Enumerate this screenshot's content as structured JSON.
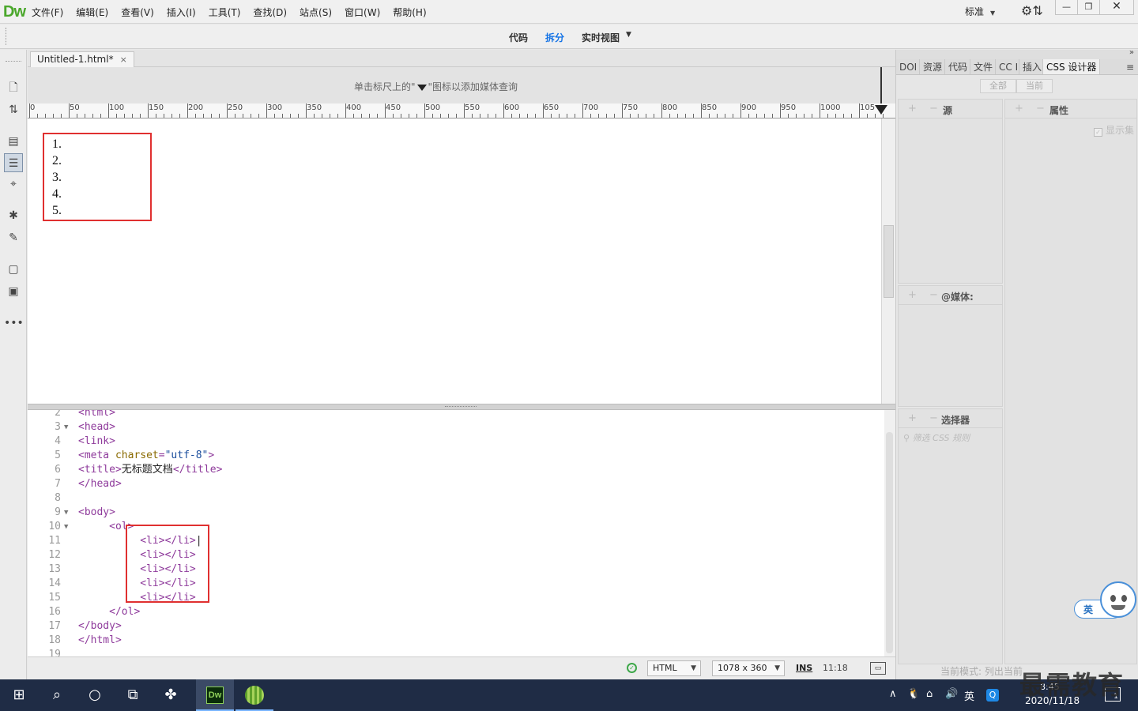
{
  "app": {
    "logo": "Dw",
    "menus": [
      "文件(F)",
      "编辑(E)",
      "查看(V)",
      "插入(I)",
      "工具(T)",
      "查找(D)",
      "站点(S)",
      "窗口(W)",
      "帮助(H)"
    ],
    "layout_label": "标准",
    "window_min": "—",
    "window_max": "❐",
    "window_close": "✕"
  },
  "views": {
    "code": "代码",
    "split": "拆分",
    "live": "实时视图",
    "active": "split"
  },
  "document": {
    "tab_title": "Untitled-1.html*",
    "tab_close": "×",
    "media_query_hint_before": "单击标尺上的\"",
    "media_query_hint_after": "\"图标以添加媒体查询",
    "ruler_labels": [
      "0",
      "50",
      "100",
      "150",
      "200",
      "250",
      "300",
      "350",
      "400",
      "450",
      "500",
      "550",
      "600",
      "650",
      "700",
      "750",
      "800",
      "850",
      "900",
      "950",
      "1000",
      "105"
    ],
    "list_items": [
      "1.",
      "2.",
      "3.",
      "4.",
      "5."
    ]
  },
  "code": {
    "lines": [
      {
        "n": "2",
        "fold": "",
        "indent": "",
        "parts": [
          {
            "c": "tag",
            "t": "<html>"
          }
        ]
      },
      {
        "n": "3",
        "fold": "▼",
        "indent": "",
        "parts": [
          {
            "c": "tag",
            "t": "<head>"
          }
        ]
      },
      {
        "n": "4",
        "fold": "",
        "indent": "",
        "parts": [
          {
            "c": "tag",
            "t": "<link>"
          }
        ]
      },
      {
        "n": "5",
        "fold": "",
        "indent": "",
        "parts": [
          {
            "c": "tag",
            "t": "<meta "
          },
          {
            "c": "attr",
            "t": "charset"
          },
          {
            "c": "tag",
            "t": "="
          },
          {
            "c": "str",
            "t": "\"utf-8\""
          },
          {
            "c": "tag",
            "t": ">"
          }
        ]
      },
      {
        "n": "6",
        "fold": "",
        "indent": "",
        "parts": [
          {
            "c": "tag",
            "t": "<title>"
          },
          {
            "c": "plain",
            "t": "无标题文档"
          },
          {
            "c": "tag",
            "t": "</title>"
          }
        ]
      },
      {
        "n": "7",
        "fold": "",
        "indent": "",
        "parts": [
          {
            "c": "tag",
            "t": "</head>"
          }
        ]
      },
      {
        "n": "8",
        "fold": "",
        "indent": "",
        "parts": []
      },
      {
        "n": "9",
        "fold": "▼",
        "indent": "",
        "parts": [
          {
            "c": "tag",
            "t": "<body>"
          }
        ]
      },
      {
        "n": "10",
        "fold": "▼",
        "indent": "     ",
        "parts": [
          {
            "c": "tag",
            "t": "<ol>"
          }
        ]
      },
      {
        "n": "11",
        "fold": "",
        "indent": "          ",
        "parts": [
          {
            "c": "tag",
            "t": "<li></li>"
          },
          {
            "c": "plain",
            "t": "|"
          }
        ]
      },
      {
        "n": "12",
        "fold": "",
        "indent": "          ",
        "parts": [
          {
            "c": "tag",
            "t": "<li></li>"
          }
        ]
      },
      {
        "n": "13",
        "fold": "",
        "indent": "          ",
        "parts": [
          {
            "c": "tag",
            "t": "<li></li>"
          }
        ]
      },
      {
        "n": "14",
        "fold": "",
        "indent": "          ",
        "parts": [
          {
            "c": "tag",
            "t": "<li></li>"
          }
        ]
      },
      {
        "n": "15",
        "fold": "",
        "indent": "          ",
        "parts": [
          {
            "c": "tag",
            "t": "<li></li>"
          }
        ]
      },
      {
        "n": "16",
        "fold": "",
        "indent": "     ",
        "parts": [
          {
            "c": "tag",
            "t": "</ol>"
          }
        ]
      },
      {
        "n": "17",
        "fold": "",
        "indent": "",
        "parts": [
          {
            "c": "tag",
            "t": "</body>"
          }
        ]
      },
      {
        "n": "18",
        "fold": "",
        "indent": "",
        "parts": [
          {
            "c": "tag",
            "t": "</html>"
          }
        ]
      },
      {
        "n": "19",
        "fold": "",
        "indent": "",
        "parts": []
      }
    ]
  },
  "status": {
    "ok_icon": "check-icon",
    "language": "HTML",
    "size": "1078 x 360",
    "ins": "INS",
    "position": "11:18"
  },
  "right_panel": {
    "tabs": [
      "DOI",
      "资源",
      "代码",
      "文件",
      "CC I",
      "插入",
      "CSS 设计器"
    ],
    "active_tab": "CSS 设计器",
    "filter_all": "全部",
    "filter_current": "当前",
    "sources_title": "源",
    "properties_title": "属性",
    "show_set": "显示集",
    "media_title": "@媒体:",
    "selectors_title": "选择器",
    "selector_filter_placeholder": "筛选 CSS 规则",
    "mode_note": "当前模式: 列出当前"
  },
  "taskbar": {
    "ime_label": "英",
    "clock_time": "8:45",
    "clock_date": "2020/11/18",
    "notifications": "1"
  },
  "overlay": {
    "watermark": "最需教育",
    "ime_float_label": "英"
  }
}
